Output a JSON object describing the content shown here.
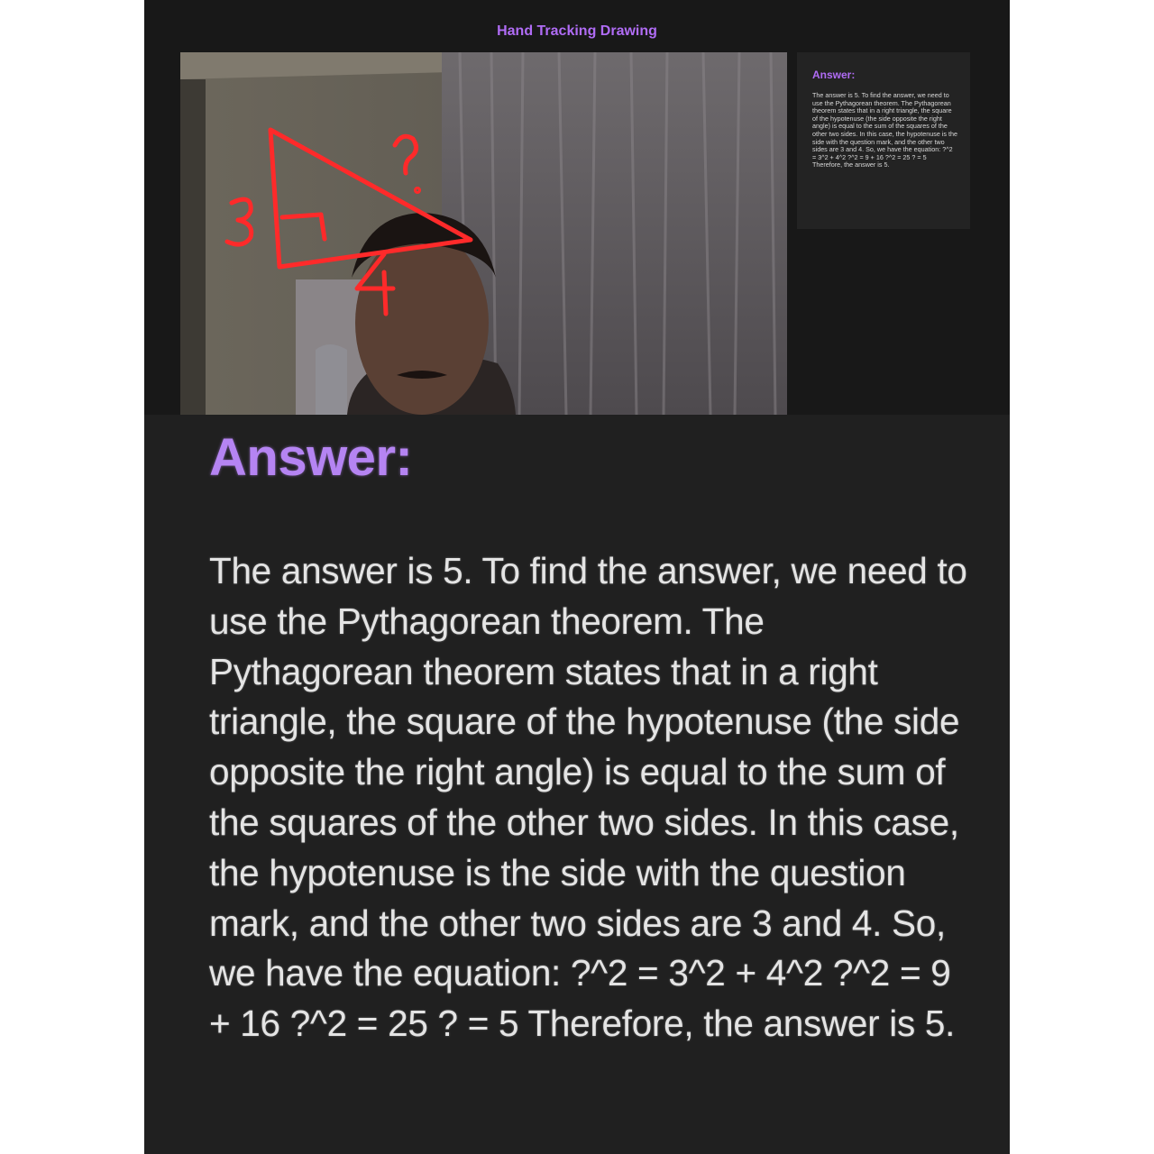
{
  "app": {
    "title": "Hand Tracking Drawing"
  },
  "video": {
    "drawing_labels": {
      "side_a": "3",
      "side_b": "4",
      "hypotenuse": "?"
    },
    "stroke_color": "#ff2a2a"
  },
  "answer": {
    "heading": "Answer:",
    "text": "The answer is 5. To find the answer, we need to use the Pythagorean theorem. The Pythagorean theorem states that in a right triangle, the square of the hypotenuse (the side opposite the right angle) is equal to the sum of the squares of the other two sides. In this case, the hypotenuse is the side with the question mark, and the other two sides are 3 and 4. So, we have the equation: ?^2 = 3^2 + 4^2 ?^2 = 9 + 16 ?^2 = 25 ? = 5 Therefore, the answer is 5."
  },
  "colors": {
    "accent": "#b06cf5",
    "background": "#181818",
    "panel": "#232323"
  }
}
